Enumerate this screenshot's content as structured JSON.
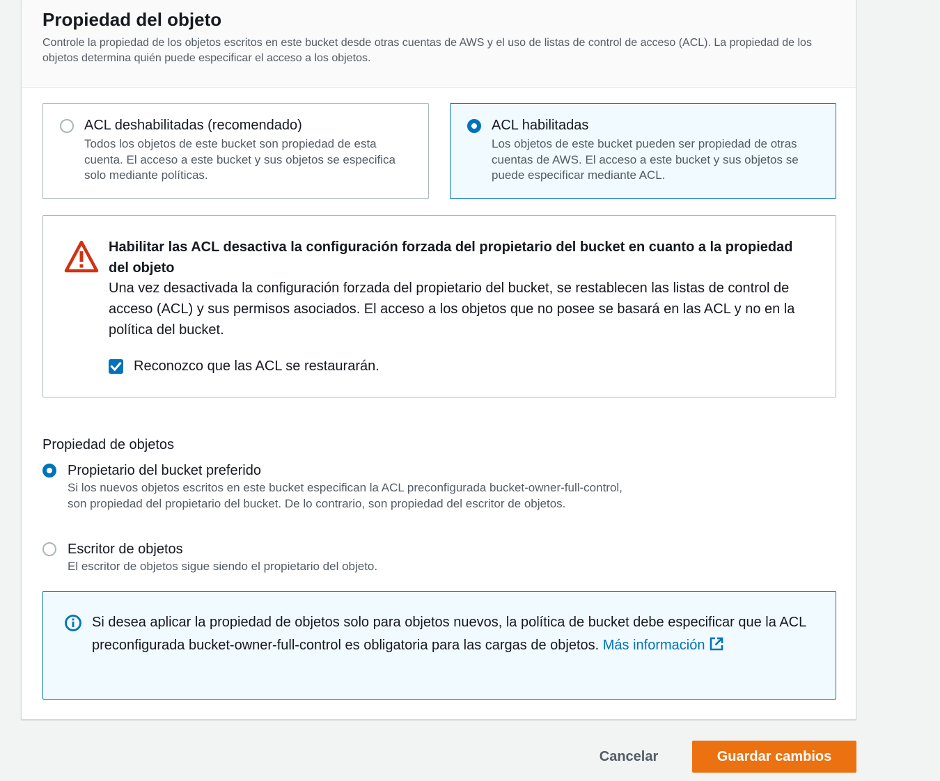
{
  "section": {
    "title": "Propiedad del objeto",
    "description": "Controle la propiedad de los objetos escritos en este bucket desde otras cuentas de AWS y el uso de listas de control de acceso (ACL). La propiedad de los objetos determina quién puede especificar el acceso a los objetos."
  },
  "acl_tiles": [
    {
      "title": "ACL deshabilitadas (recomendado)",
      "description": "Todos los objetos de este bucket son propiedad de esta cuenta. El acceso a este bucket y sus objetos se especifica solo mediante políticas.",
      "selected": false
    },
    {
      "title": "ACL habilitadas",
      "description": "Los objetos de este bucket pueden ser propiedad de otras cuentas de AWS. El acceso a este bucket y sus objetos se puede especificar mediante ACL.",
      "selected": true
    }
  ],
  "warning": {
    "icon": "warning-triangle-icon",
    "title": "Habilitar las ACL desactiva la configuración forzada del propietario del bucket en cuanto a la propiedad del objeto",
    "text": "Una vez desactivada la configuración forzada del propietario del bucket, se restablecen las listas de control de acceso (ACL) y sus permisos asociados. El acceso a los objetos que no posee se basará en las ACL y no en la política del bucket.",
    "checkbox_label": "Reconozco que las ACL se restaurarán.",
    "checkbox_checked": true
  },
  "ownership": {
    "label": "Propiedad de objetos",
    "options": [
      {
        "title": "Propietario del bucket preferido",
        "description": "Si los nuevos objetos escritos en este bucket especifican la ACL preconfigurada bucket-owner-full-control, son propiedad del propietario del bucket. De lo contrario, son propiedad del escritor de objetos.",
        "selected": true
      },
      {
        "title": "Escritor de objetos",
        "description": "El escritor de objetos sigue siendo el propietario del objeto.",
        "selected": false
      }
    ]
  },
  "info": {
    "icon": "info-circle-icon",
    "text": "Si desea aplicar la propiedad de objetos solo para objetos nuevos, la política de bucket debe especificar que la ACL preconfigurada bucket-owner-full-control es obligatoria para las cargas de objetos.",
    "link_label": "Más información"
  },
  "actions": {
    "cancel_label": "Cancelar",
    "save_label": "Guardar cambios"
  },
  "colors": {
    "accent": "#0073bb",
    "warning": "#d13212",
    "primary_button": "#ec7211"
  }
}
